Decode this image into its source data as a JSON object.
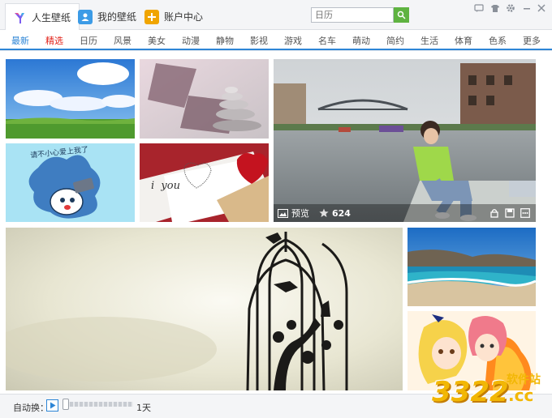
{
  "tabs": [
    {
      "label": "人生壁纸",
      "icon": "app-logo-icon",
      "color": "#6e4bd8"
    },
    {
      "label": "我的壁纸",
      "icon": "user-icon",
      "color": "#3c9be6"
    },
    {
      "label": "账户中心",
      "icon": "plus-icon",
      "color": "#f0a500"
    }
  ],
  "search": {
    "placeholder": "日历"
  },
  "categories": [
    "最新",
    "精选",
    "日历",
    "风景",
    "美女",
    "动漫",
    "静物",
    "影视",
    "游戏",
    "名车",
    "萌动",
    "简约",
    "生活",
    "体育",
    "色系",
    "更多"
  ],
  "active_category": "最新",
  "highlight_category": "精选",
  "featured": {
    "preview_label": "预览",
    "favorites_count": "624"
  },
  "cartoon_text": "请不小心爱上我了",
  "card_text": "i  you",
  "bottom": {
    "auto_change_label": "自动换：",
    "interval": "1天"
  },
  "watermark": {
    "brand": "3322",
    "suffix": ".cc",
    "tag": "软件站"
  },
  "colors": {
    "accent": "#2d85d6",
    "highlight": "#e2231a",
    "play": "#2d85d6"
  }
}
